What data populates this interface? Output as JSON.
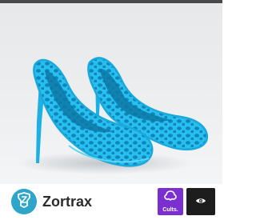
{
  "photo": {
    "subject_icon": "lattice-high-heel-shoes",
    "shoe_color": "#21b8ea",
    "background_color": "#e9ebed"
  },
  "designer": {
    "name": "Zortrax",
    "avatar_icon": "zortrax-logo-icon",
    "avatar_color": "#2ea5c9"
  },
  "actions": {
    "cults_label": "Cults.",
    "cults_icon": "cults-logo-icon",
    "cults_color": "#7b2fd1",
    "view_icon": "eye-icon",
    "view_color": "#1d1d1d"
  }
}
